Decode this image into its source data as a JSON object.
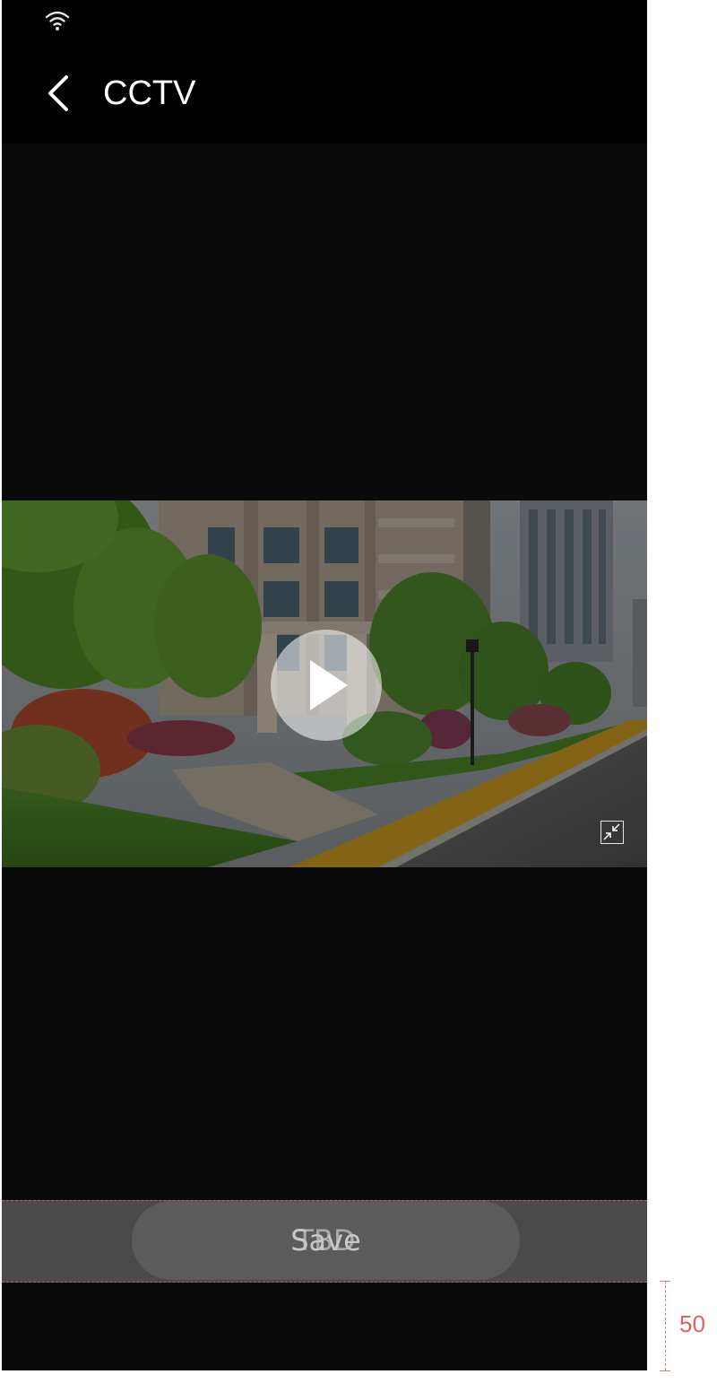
{
  "header": {
    "title": "CCTV"
  },
  "icons": {
    "status": "wifi-icon",
    "back": "chevron-left-icon",
    "play": "play-icon",
    "exit_fullscreen": "exit-fullscreen-icon"
  },
  "save_bar": {
    "label": "Save",
    "overlay_label": "TBD"
  },
  "spec": {
    "measure_value": "50"
  },
  "colors": {
    "background": "#0a0a0a",
    "header": "#000000",
    "save_bar": "#4a4a4a",
    "annotation": "#e06060"
  }
}
